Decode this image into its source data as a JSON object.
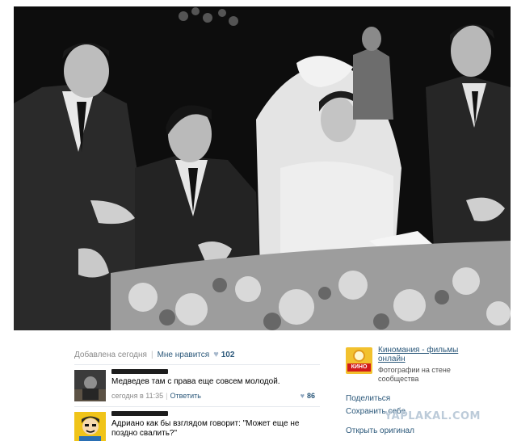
{
  "post": {
    "meta": {
      "added": "Добавлена сегодня",
      "like_label": "Мне нравится",
      "likes": "102"
    }
  },
  "comments": [
    {
      "text": "Медведев там с права еще совсем молодой.",
      "time": "сегодня в 11:35",
      "reply": "Ответить",
      "likes": "86"
    },
    {
      "text": "Адриано как бы взглядом говорит: \"Может еще не поздно свалить?\""
    }
  ],
  "group": {
    "logo_text": "КИНО",
    "name": "Киномания - фильмы онлайн",
    "subtitle": "Фотографии на стене сообщества"
  },
  "actions": {
    "share": "Поделиться",
    "save": "Сохранить себе",
    "original": "Открыть оригинал"
  },
  "watermark": "YAPLAKAL.COM",
  "icons": {
    "like": "heart-icon",
    "comment_like": "heart-icon"
  },
  "colors": {
    "link": "#2b587a",
    "muted": "#8a8a8a",
    "photo_bg": "#0c0c0c"
  }
}
